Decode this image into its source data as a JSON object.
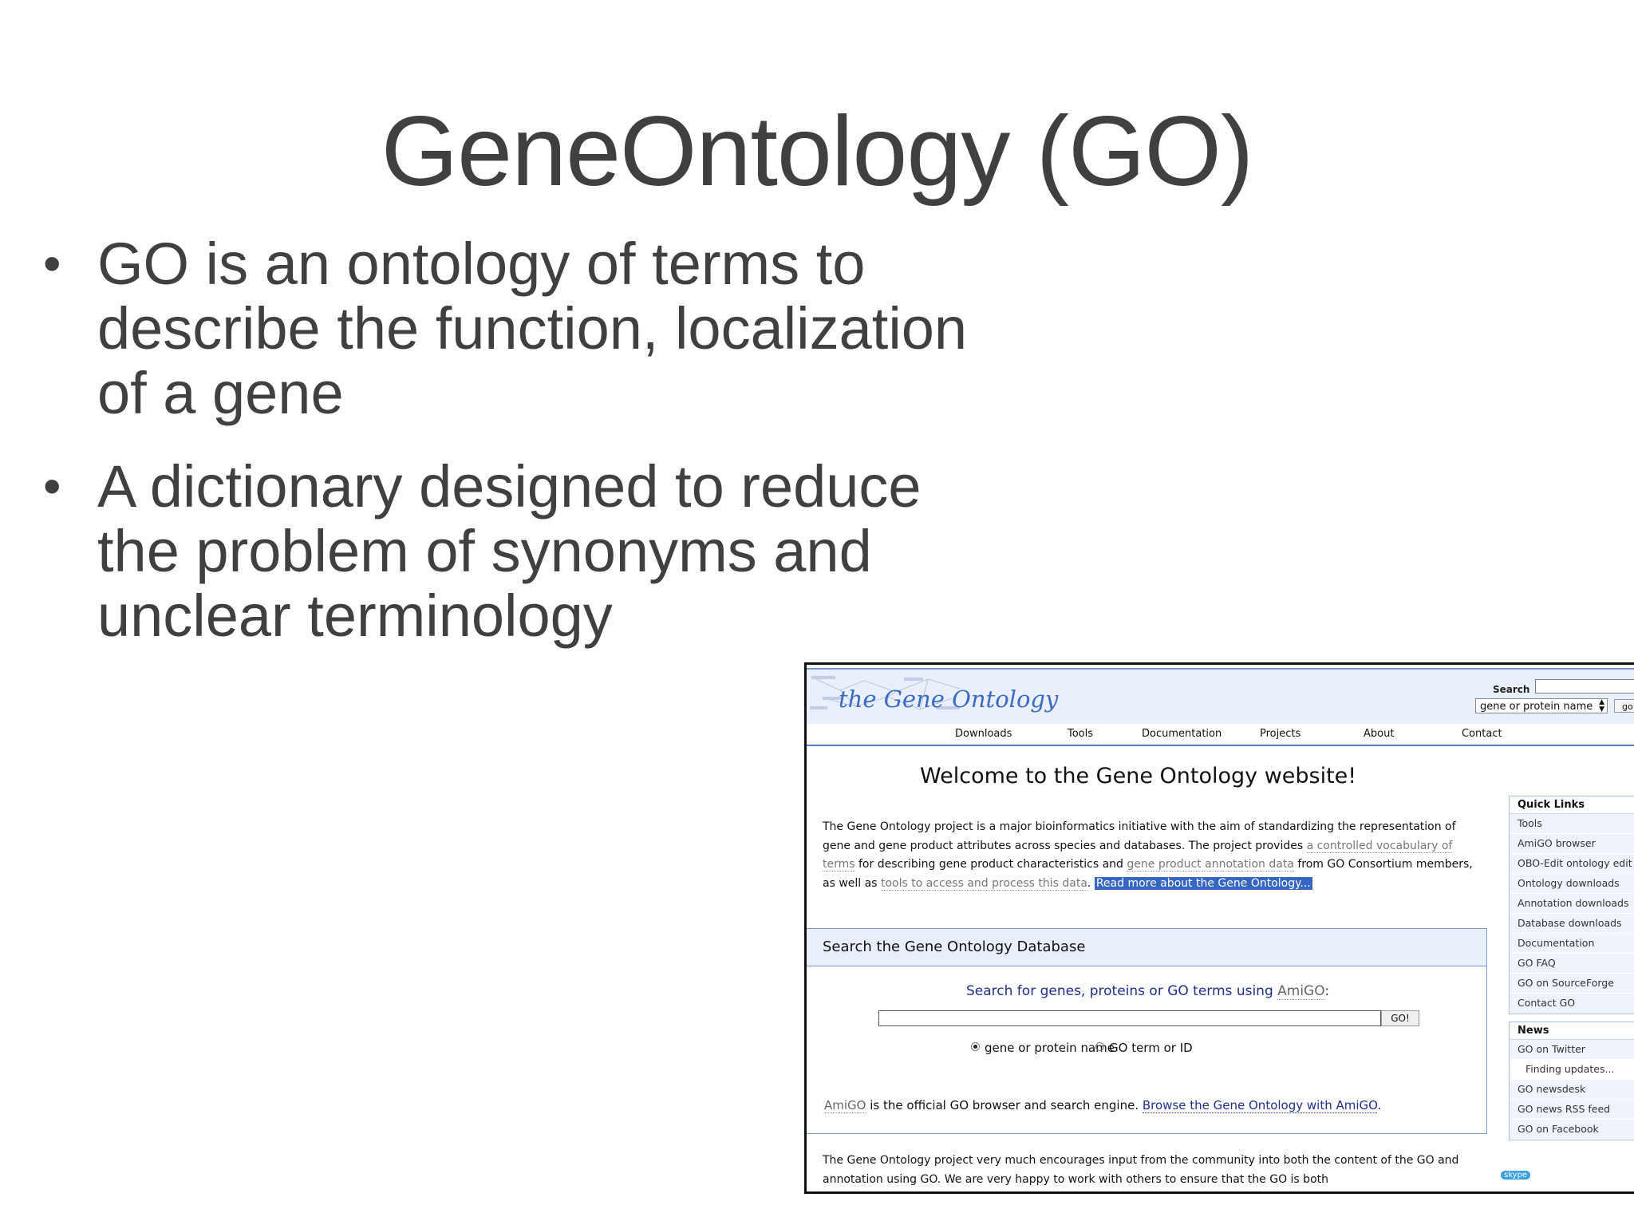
{
  "slide": {
    "title": "GeneOntology (GO)",
    "bullets": [
      {
        "line1": "GO is an ontology of terms to",
        "line2": "describe the function, localization",
        "line3": "of a gene"
      },
      {
        "line1": "A dictionary designed to reduce",
        "line2": "the problem of synonyms and",
        "line3": "unclear terminology"
      }
    ],
    "bullet_symbol": "•"
  },
  "website": {
    "logo": "the Gene Ontology",
    "header_search": {
      "label": "Search",
      "select_value": "gene or protein name",
      "button": "go"
    },
    "nav": [
      "Downloads",
      "Tools",
      "Documentation",
      "Projects",
      "About",
      "Contact"
    ],
    "welcome": "Welcome to the Gene Ontology website!",
    "intro": {
      "t1": "The Gene Ontology project is a major bioinformatics initiative with the aim of standardizing the representation of gene and gene product attributes across species and databases. The project provides ",
      "link1": "a controlled vocabulary of terms",
      "t2": " for describing gene product characteristics and ",
      "link2": "gene product annotation data",
      "t3": " from GO Consortium members, as well as ",
      "link3": "tools to access and process this data",
      "t4": ". ",
      "read_more": "Read more about the Gene Ontology..."
    },
    "search_section": {
      "heading": "Search the Gene Ontology Database",
      "prompt_text": "Search for genes, proteins or GO terms using ",
      "prompt_link": "AmiGO",
      "prompt_end": ":",
      "button": "GO!",
      "radio1": "gene or protein name",
      "radio2": "GO term or ID",
      "amigo_link": "AmiGO",
      "amigo_text": " is the official GO browser and search engine. ",
      "browse_link": "Browse the Gene Ontology with AmiGO",
      "browse_end": "."
    },
    "bottom_text": "The Gene Ontology project very much encourages input from the community into both the content of the GO and annotation using GO. We are very happy to work with others to ensure that the GO is both",
    "quick_links": {
      "heading": "Quick Links",
      "items": [
        "Tools",
        "AmiGO browser",
        "OBO-Edit ontology edit",
        "Ontology downloads",
        "Annotation downloads",
        "Database downloads",
        "Documentation",
        "GO FAQ",
        "GO on SourceForge",
        "Contact GO"
      ]
    },
    "news": {
      "heading": "News",
      "items": [
        "GO on Twitter",
        "Finding updates...",
        "GO newsdesk",
        "GO news RSS feed",
        "GO on Facebook"
      ]
    },
    "skype_badge": "skype"
  }
}
